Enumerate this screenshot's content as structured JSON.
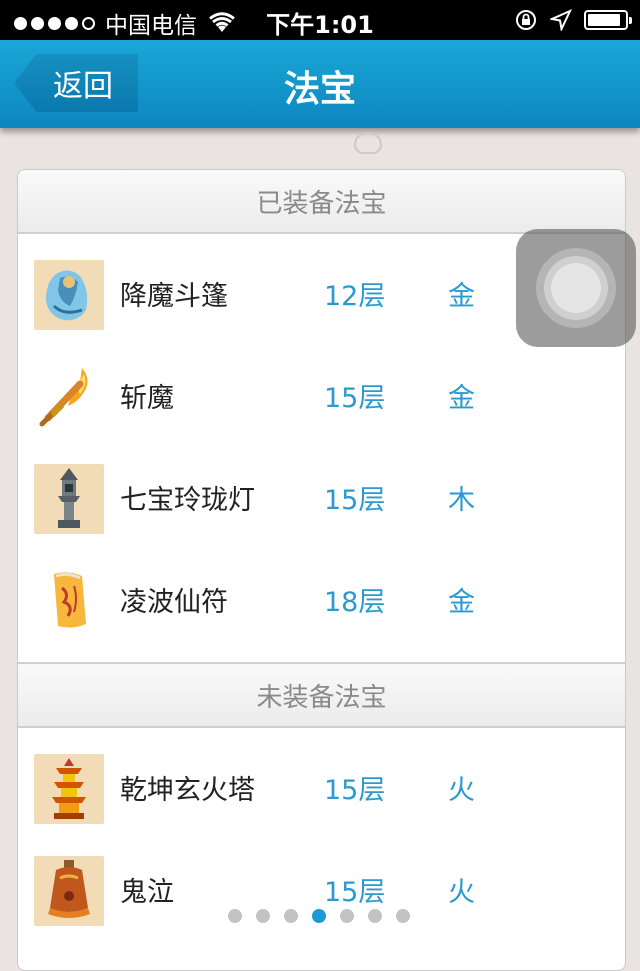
{
  "status_bar": {
    "signal_bars": 4,
    "signal_total": 5,
    "carrier": "中国电信",
    "time": "下午1:01",
    "battery_level": 0.9,
    "icons": [
      "wifi-icon",
      "rotation-lock-icon",
      "location-arrow-icon",
      "battery-icon"
    ]
  },
  "nav": {
    "back_label": "返回",
    "title": "法宝"
  },
  "sections": [
    {
      "header": "已装备法宝",
      "items": [
        {
          "name": "降魔斗篷",
          "layer": "12层",
          "element": "金",
          "icon": "cloak-icon"
        },
        {
          "name": "斩魔",
          "layer": "15层",
          "element": "金",
          "icon": "flaming-sword-icon"
        },
        {
          "name": "七宝玲珑灯",
          "layer": "15层",
          "element": "木",
          "icon": "stone-lantern-icon"
        },
        {
          "name": "凌波仙符",
          "layer": "18层",
          "element": "金",
          "icon": "talisman-icon"
        }
      ]
    },
    {
      "header": "未装备法宝",
      "items": [
        {
          "name": "乾坤玄火塔",
          "layer": "15层",
          "element": "火",
          "icon": "pagoda-icon"
        },
        {
          "name": "鬼泣",
          "layer": "15层",
          "element": "火",
          "icon": "bell-icon"
        }
      ]
    }
  ],
  "pager": {
    "total": 7,
    "current": 4
  },
  "colors": {
    "accent": "#1a9bd6",
    "nav_bg": "#1aa7d8",
    "value_text": "#2a9ad0"
  }
}
